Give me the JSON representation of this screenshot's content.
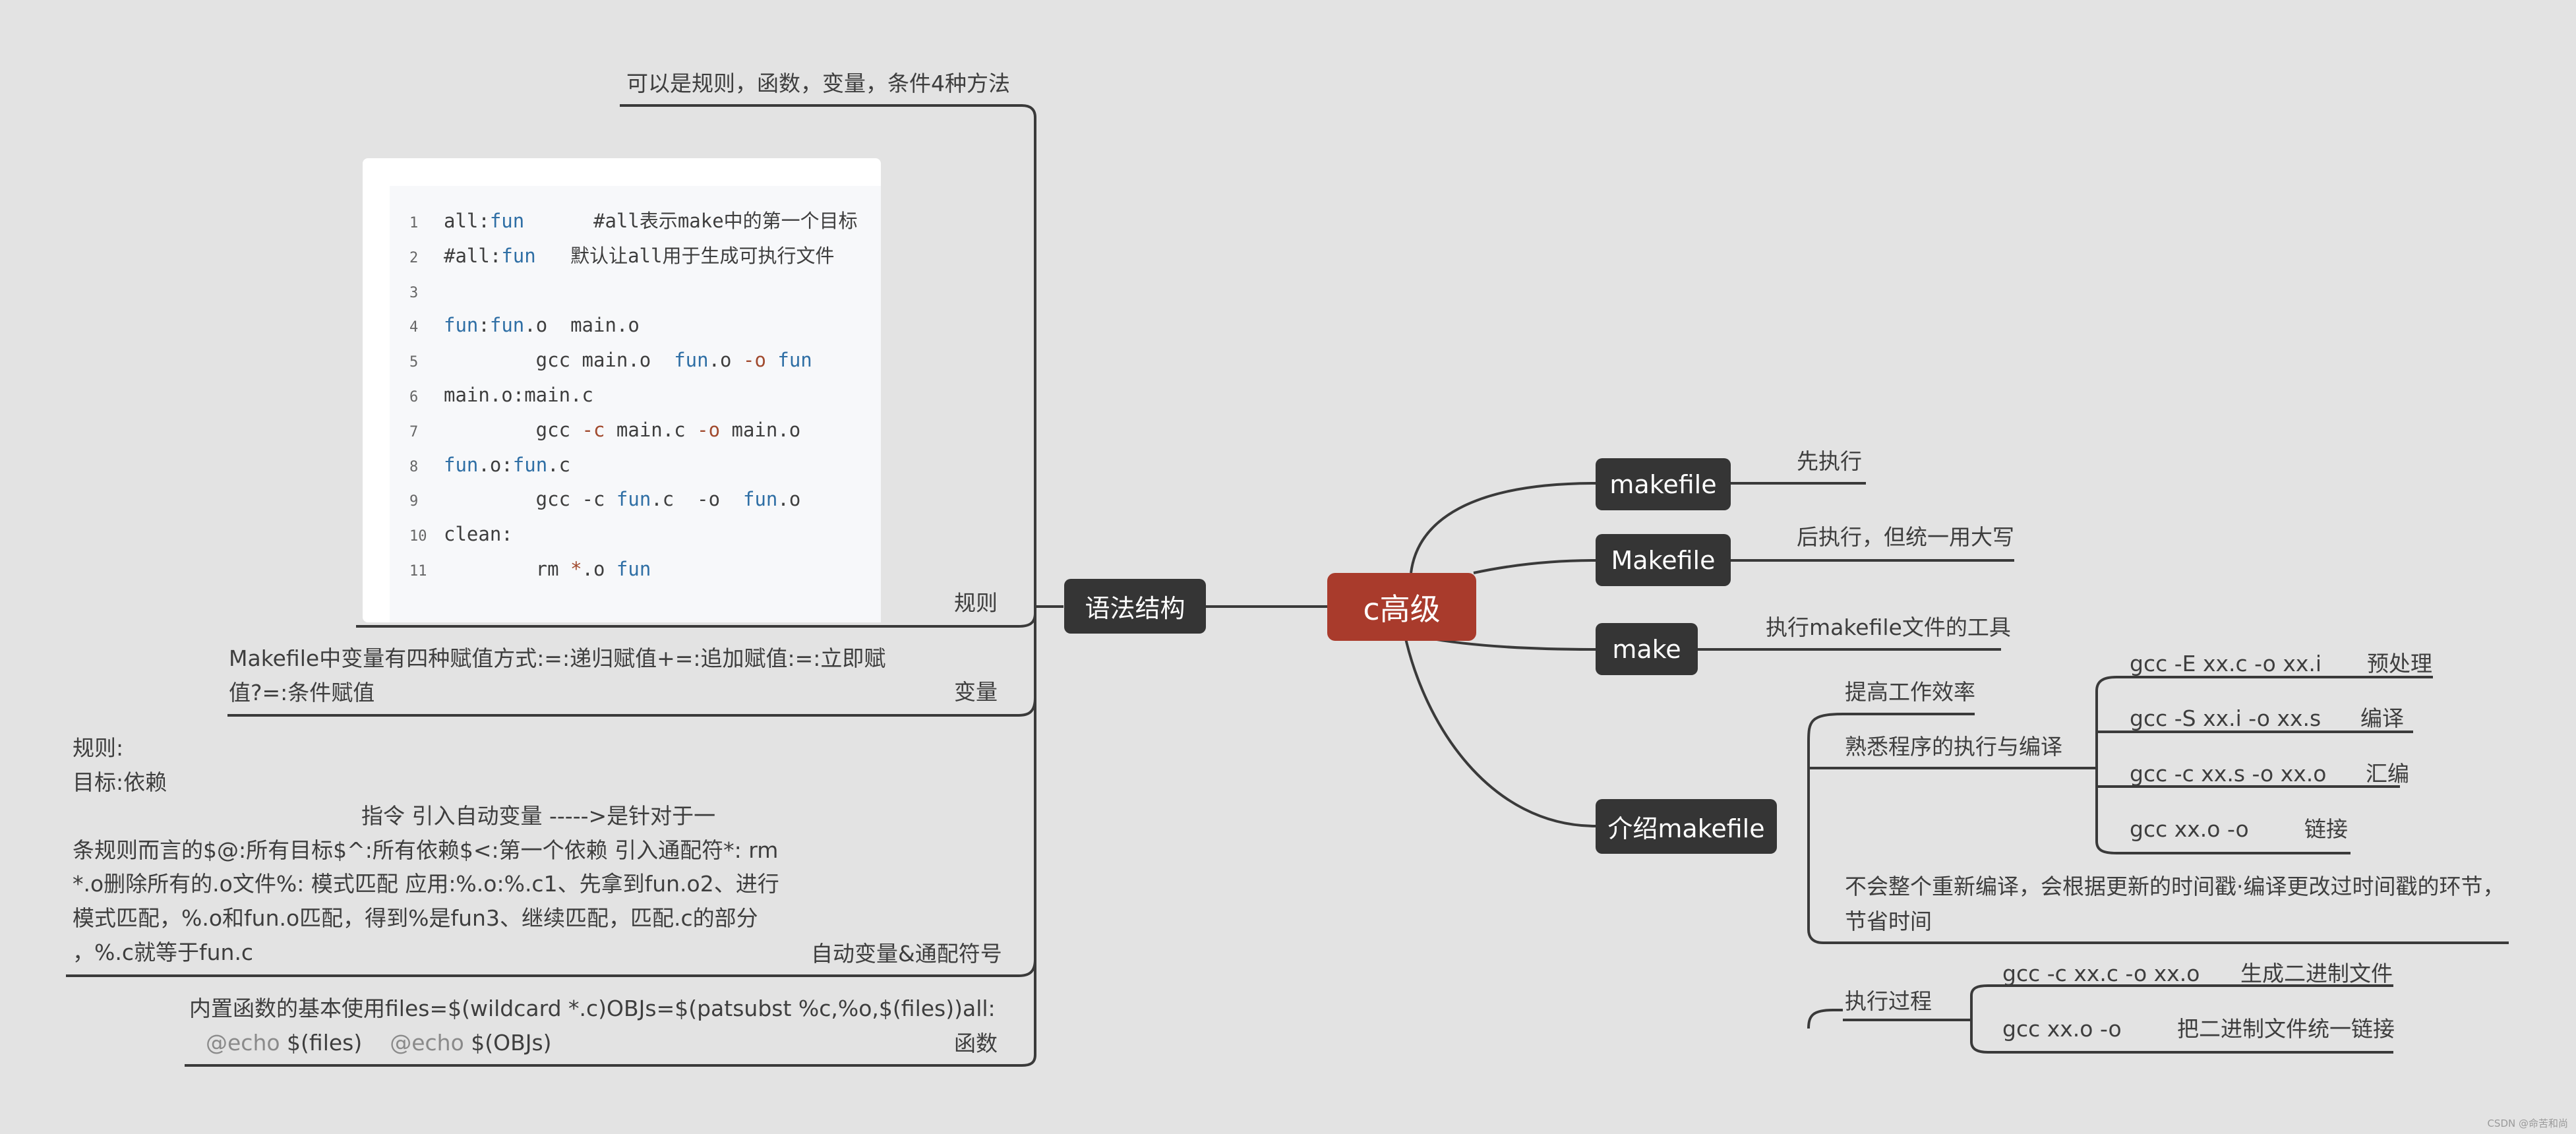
{
  "root": "c高级",
  "right": {
    "makefile": {
      "label": "makefile",
      "note": "先执行"
    },
    "Makefile": {
      "label": "Makefile",
      "note": "后执行，但统一用大写"
    },
    "make": {
      "label": "make",
      "note": "执行makefile文件的工具"
    },
    "intro": {
      "label": "介绍makefile",
      "efficiency": "提高工作效率",
      "familiar": {
        "label": "熟悉程序的执行与编译",
        "steps": [
          {
            "cmd": "gcc  -E xx.c -o xx.i",
            "name": "预处理"
          },
          {
            "cmd": "gcc -S xx.i -o xx.s",
            "name": "编译"
          },
          {
            "cmd": "gcc -c xx.s -o xx.o",
            "name": "汇编"
          },
          {
            "cmd": "gcc xx.o -o",
            "name": "链接"
          }
        ]
      },
      "recompile": "不会整个重新编译，会根据更新的时间戳·编译更改过时间戳的环节，节省时间",
      "process": {
        "label": "执行过程",
        "steps": [
          {
            "cmd": "gcc -c xx.c -o xx.o",
            "name": "生成二进制文件"
          },
          {
            "cmd": "gcc xx.o -o",
            "name": "把二进制文件统一链接"
          }
        ]
      }
    }
  },
  "left": {
    "syntax": {
      "label": "语法结构",
      "top_note": "可以是规则，函数，变量，条件4种方法",
      "rules": {
        "label": "规则",
        "code": [
          {
            "n": "1",
            "parts": [
              [
                "all:",
                ""
              ],
              [
                "fun",
                "kw"
              ],
              [
                "      #all表示make中的第一个目标",
                ""
              ]
            ]
          },
          {
            "n": "2",
            "parts": [
              [
                "#all:",
                ""
              ],
              [
                "fun",
                "kw"
              ],
              [
                "   默认让all用于生成可执行文件",
                ""
              ]
            ]
          },
          {
            "n": "3",
            "parts": []
          },
          {
            "n": "4",
            "parts": [
              [
                "fun",
                "kw"
              ],
              [
                ":",
                ""
              ],
              [
                "fun",
                "kw"
              ],
              [
                ".o  main.o",
                ""
              ]
            ]
          },
          {
            "n": "5",
            "parts": [
              [
                "        gcc main.o  ",
                ""
              ],
              [
                "fun",
                "kw"
              ],
              [
                ".o ",
                ""
              ],
              [
                "-o",
                "op"
              ],
              [
                " ",
                ""
              ],
              [
                "fun",
                "kw"
              ]
            ]
          },
          {
            "n": "6",
            "parts": [
              [
                "main.o:main.c",
                ""
              ]
            ]
          },
          {
            "n": "7",
            "parts": [
              [
                "        gcc ",
                ""
              ],
              [
                "-c",
                "op"
              ],
              [
                " main.c ",
                ""
              ],
              [
                "-o",
                "op"
              ],
              [
                " main.o",
                ""
              ]
            ]
          },
          {
            "n": "8",
            "parts": [
              [
                "fun",
                "kw"
              ],
              [
                ".o:",
                ""
              ],
              [
                "fun",
                "kw"
              ],
              [
                ".c",
                ""
              ]
            ]
          },
          {
            "n": "9",
            "parts": [
              [
                "        gcc -c ",
                ""
              ],
              [
                "fun",
                "kw"
              ],
              [
                ".c  -o  ",
                ""
              ],
              [
                "fun",
                "kw"
              ],
              [
                ".o",
                ""
              ]
            ]
          },
          {
            "n": "10",
            "parts": [
              [
                "clean:",
                ""
              ]
            ]
          },
          {
            "n": "11",
            "parts": [
              [
                "        rm ",
                ""
              ],
              [
                "*",
                "op"
              ],
              [
                ".o ",
                ""
              ],
              [
                "fun",
                "kw"
              ]
            ]
          }
        ]
      },
      "variables": {
        "label": "变量",
        "text": "Makefile中变量有四种赋值方式:=:递归赋值+=:追加赋值:=:立即赋值?=:条件赋值"
      },
      "auto": {
        "label": "自动变量&通配符号",
        "lines": [
          "规则:",
          "目标:依赖",
          "指令     引入自动变量 ----->是针对于一",
          "条规则而言的$@:所有目标$^:所有依赖$<:第一个依赖   引入通配符*: rm",
          "*.o删除所有的.o文件%:  模式匹配  应用:%.o:%.c1、先拿到fun.o2、进行",
          "模式匹配，%.o和fun.o匹配，得到%是fun3、继续匹配，匹配.c的部分",
          "，%.c就等于fun.c"
        ]
      },
      "functions": {
        "label": "函数",
        "line1": "内置函数的基本使用files=$(wildcard *.c)OBJs=$(patsubst %c,%o,$(files))all:",
        "echo1": "@echo",
        "arg1": " $(files)",
        "echo2": "@echo",
        "arg2": " $(OBJs)"
      }
    }
  },
  "watermark": "CSDN @命苦和尚"
}
